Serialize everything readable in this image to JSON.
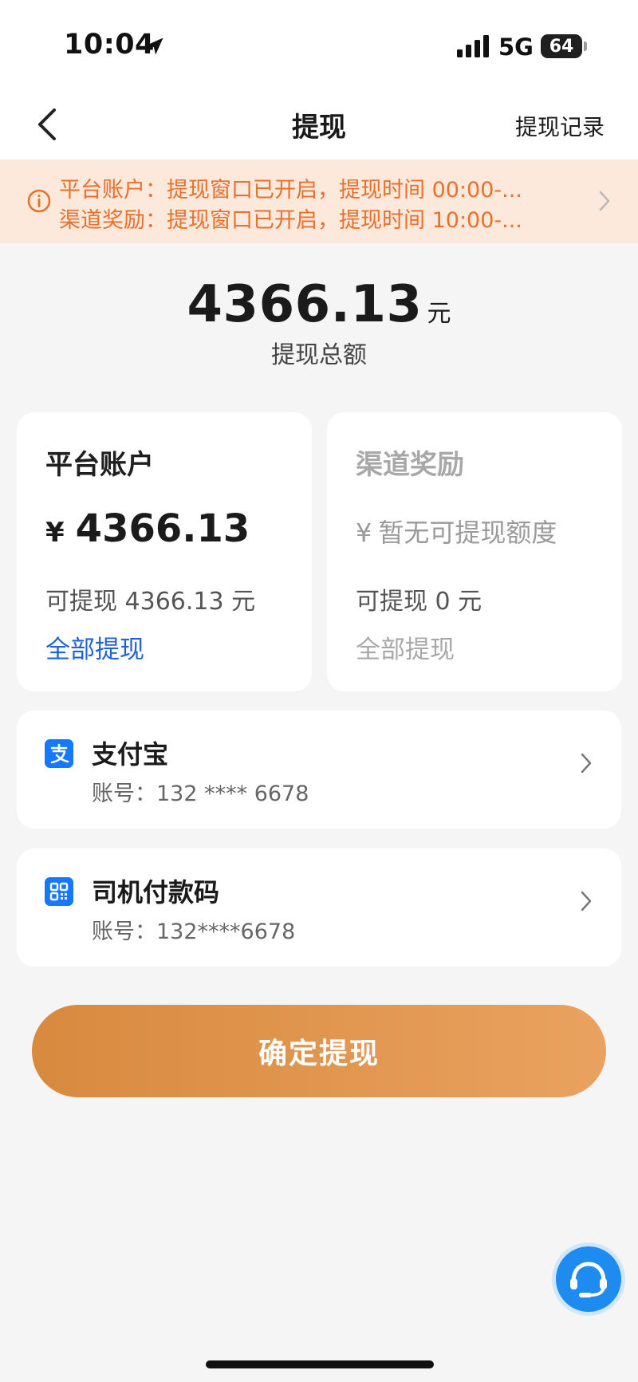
{
  "status_bar": {
    "time": "10:04",
    "network": "5G",
    "battery": "64"
  },
  "nav": {
    "title": "提现",
    "right_link": "提现记录"
  },
  "notice": {
    "line1": "平台账户：提现窗口已开启，提现时间 00:00-...",
    "line2": "渠道奖励：提现窗口已开启，提现时间 10:00-..."
  },
  "total": {
    "amount": "4366.13",
    "unit": "元",
    "label": "提现总额"
  },
  "accounts": [
    {
      "title": "平台账户",
      "currency": "¥",
      "amount": "4366.13",
      "available": "可提现 4366.13 元",
      "action": "全部提现"
    },
    {
      "title": "渠道奖励",
      "currency": "¥",
      "amount_text": "暂无可提现额度",
      "available": "可提现 0 元",
      "action": "全部提现"
    }
  ],
  "payment_methods": [
    {
      "name": "支付宝",
      "account": "账号：132 **** 6678",
      "icon": "alipay-icon"
    },
    {
      "name": "司机付款码",
      "account": "账号：132****6678",
      "icon": "qr-code-icon"
    }
  ],
  "confirm_button": "确定提现",
  "colors": {
    "accent_orange": "#e9a25f",
    "link_blue": "#1f63d6",
    "notice_text": "#e8702b",
    "notice_bg": "#fde9dc"
  }
}
